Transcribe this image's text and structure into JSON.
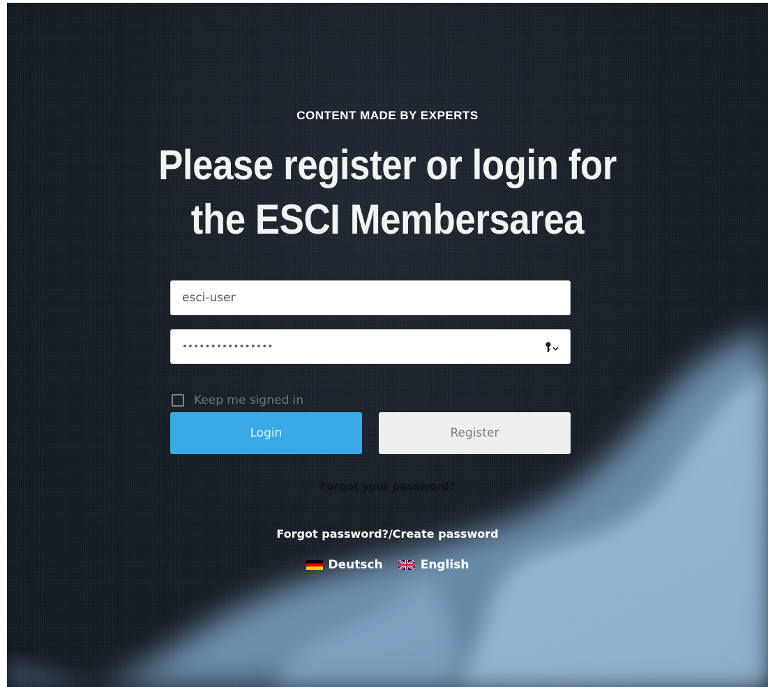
{
  "hero": {
    "eyebrow": "CONTENT MADE BY EXPERTS",
    "headline_line1": "Please register or login for",
    "headline_line2": "the ESCI Membersarea"
  },
  "login_form": {
    "username_value": "esci-user",
    "password_mask": "••••••••••••••••",
    "password_icon": "key-icon",
    "remember_label": "Keep me signed in",
    "remember_checked": false,
    "login_label": "Login",
    "register_label": "Register"
  },
  "links": {
    "forgot_password": "Forgot your password?",
    "forgot_create": "Forgot password?/Create password"
  },
  "languages": [
    {
      "label": "Deutsch",
      "flag": "flag-de-icon"
    },
    {
      "label": "English",
      "flag": "flag-uk-icon"
    }
  ],
  "colors": {
    "background": "#161c24",
    "login_button": "#3aa9e6",
    "register_button": "#efefef",
    "text_on_dark": "#ffffff"
  }
}
